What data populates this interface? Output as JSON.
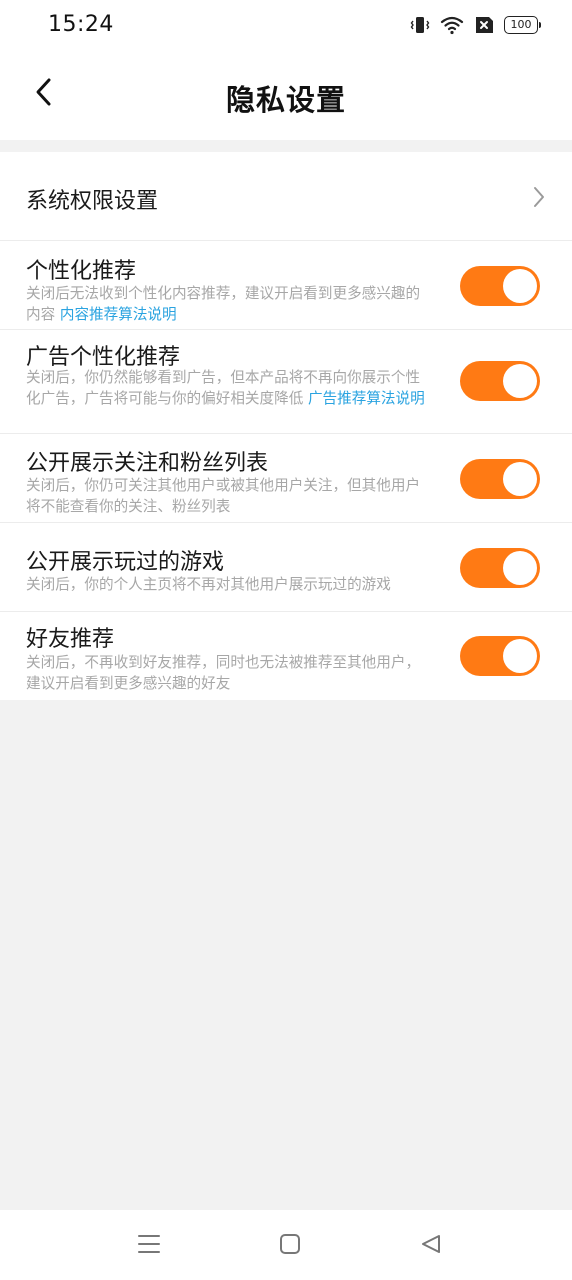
{
  "status_bar": {
    "time": "15:24",
    "battery": "100",
    "icons": [
      "vibrate-icon",
      "wifi-icon",
      "no-sim-icon",
      "battery-icon"
    ]
  },
  "header": {
    "title": "隐私设置",
    "back_icon": "chevron-left-icon"
  },
  "settings": {
    "system_permissions": {
      "label": "系统权限设置",
      "icon": "chevron-right-icon"
    },
    "items": [
      {
        "title": "个性化推荐",
        "desc": "关闭后无法收到个性化内容推荐，建议开启看到更多感兴趣的内容",
        "link": "内容推荐算法说明",
        "enabled": true
      },
      {
        "title": "广告个性化推荐",
        "desc": "关闭后，你仍然能够看到广告，但本产品将不再向你展示个性化广告，广告将可能与你的偏好相关度降低",
        "link": "广告推荐算法说明",
        "enabled": true
      },
      {
        "title": "公开展示关注和粉丝列表",
        "desc": "关闭后，你仍可关注其他用户或被其他用户关注，但其他用户将不能查看你的关注、粉丝列表",
        "link": "",
        "enabled": true
      },
      {
        "title": "公开展示玩过的游戏",
        "desc": "关闭后，你的个人主页将不再对其他用户展示玩过的游戏",
        "link": "",
        "enabled": true
      },
      {
        "title": "好友推荐",
        "desc": "关闭后，不再收到好友推荐，同时也无法被推荐至其他用户，建议开启看到更多感兴趣的好友",
        "link": "",
        "enabled": true
      }
    ]
  },
  "colors": {
    "toggle_on": "#ff7a14",
    "link": "#2aa3e0",
    "desc": "#a7a7a7",
    "background": "#f2f2f2"
  },
  "nav_bar": {
    "icons": [
      "menu-icon",
      "home-square-icon",
      "back-triangle-icon"
    ]
  }
}
